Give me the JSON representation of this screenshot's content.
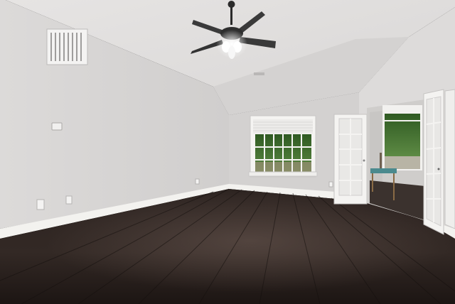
{
  "scene": {
    "kind": "photo",
    "subject": "empty-room",
    "palette": {
      "ceiling": "#e3e1e0",
      "wall_left": "#d9d7d6",
      "wall_back": "#d2d1d0",
      "wall_right": "#dcdad9",
      "floor_dark": "#1f1816",
      "floor_mid": "#3a302c",
      "trim": "#f3f2ef",
      "window_green": "#3f6a2e",
      "fan_body": "#2b2b2b"
    }
  }
}
